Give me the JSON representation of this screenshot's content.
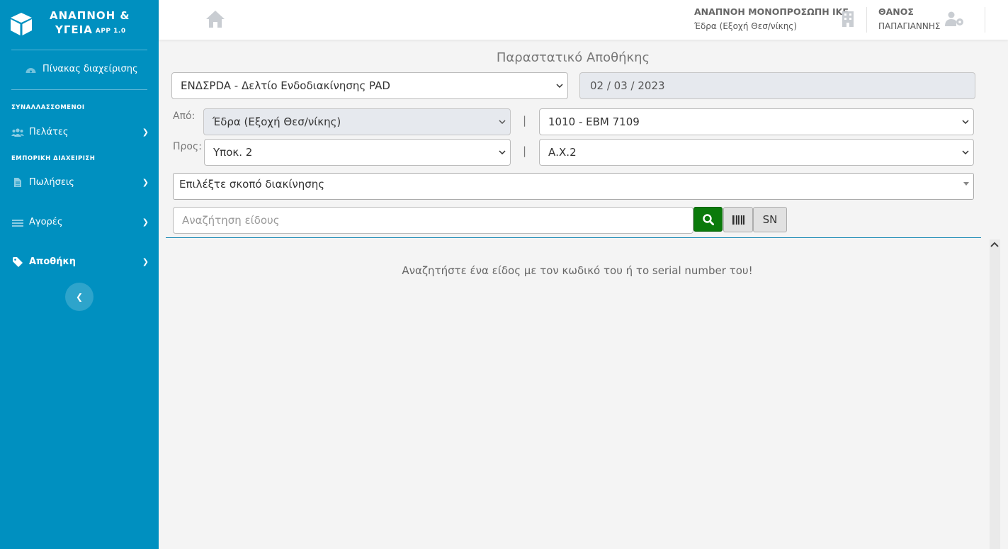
{
  "brand": {
    "line1": "ΑΝΑΠΝΟΗ &",
    "line2": "ΥΓΕΙΑ",
    "version": "APP 1.0"
  },
  "sidebar": {
    "dashboard": "Πίνακας διαχείρισης",
    "section1": "ΣΥΝΑΛΛΑΣΣΟΜΕΝΟΙ",
    "section2": "ΕΜΠΟΡΙΚΗ ΔΙΑΧΕΙΡΙΣΗ",
    "items": [
      {
        "label": "Πελάτες",
        "icon": "users-icon"
      },
      {
        "label": "Πωλήσεις",
        "icon": "file-icon"
      },
      {
        "label": "Αγορές",
        "icon": "truck-icon"
      },
      {
        "label": "Αποθήκη",
        "icon": "tag-icon",
        "active": true
      }
    ]
  },
  "topbar": {
    "company_name": "ΑΝΑΠΝΟΗ ΜΟΝΟΠΡΟΣΩΠΗ ΙΚΕ",
    "company_branch": "Έδρα (Εξοχή Θεσ/νίκης)",
    "user_first": "ΘΑΝΟΣ",
    "user_last": "ΠΑΠΑΓΙΑΝΝΗΣ"
  },
  "form": {
    "title": "Παραστατικό Αποθήκης",
    "doc_type": "ΕΝΔΣPDA - Δελτίο Ενδοδιακίνησης PAD",
    "date": "02 / 03 / 2023",
    "from_label": "Από:",
    "from_store": "Έδρα (Εξοχή Θεσ/νίκης)",
    "from_vehicle": "1010 - ΕΒΜ 7109",
    "to_label": "Προς:",
    "to_store": "Υποκ. 2",
    "to_location": "Α.Χ.2",
    "separator": "|",
    "purpose_placeholder": "Επιλέξτε σκοπό διακίνησης",
    "search_placeholder": "Αναζήτηση είδους",
    "sn_label": "SN",
    "empty_message": "Αναζητήστε ένα είδος με τον κωδικό του ή το serial number του!"
  },
  "colors": {
    "sidebar": "#0090c0",
    "search_button": "#0b7a0b",
    "accent_line": "#1a8ab5"
  }
}
